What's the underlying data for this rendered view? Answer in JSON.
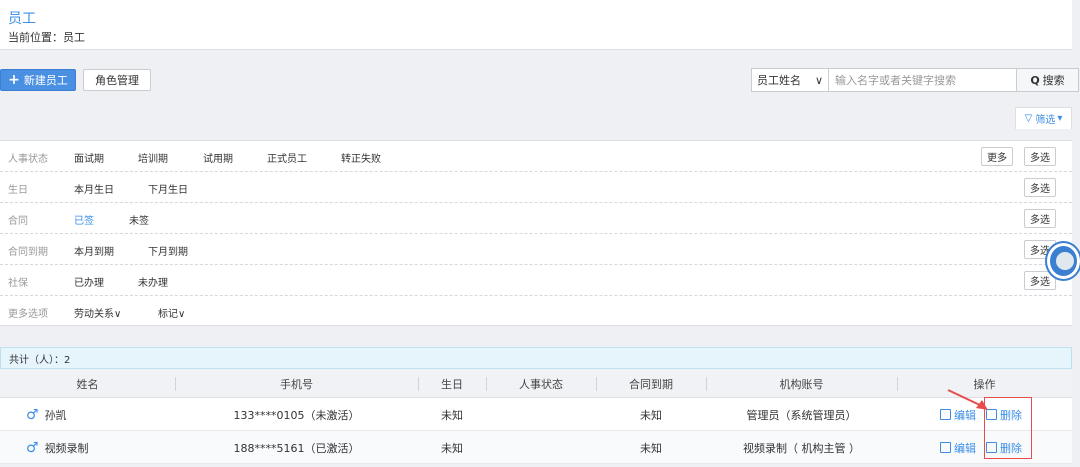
{
  "header": {
    "title": "员工",
    "breadcrumb": "当前位置：员工"
  },
  "toolbar": {
    "new_label": "新建员工",
    "role_label": "角色管理"
  },
  "search": {
    "field_label": "员工姓名",
    "placeholder": "输入名字或者关键字搜索",
    "button_label": "搜索"
  },
  "filter_toggle": {
    "label": "筛选"
  },
  "filters": [
    {
      "label": "人事状态",
      "options": [
        "面试期",
        "培训期",
        "试用期",
        "正式员工",
        "转正失败"
      ],
      "more_label": "更多",
      "multi_label": "多选"
    },
    {
      "label": "生日",
      "options": [
        "本月生日",
        "下月生日"
      ],
      "multi_label": "多选"
    },
    {
      "label": "合同",
      "options": [
        "已签",
        "未签"
      ],
      "active": "已签",
      "multi_label": "多选"
    },
    {
      "label": "合同到期",
      "options": [
        "本月到期",
        "下月到期"
      ],
      "multi_label": "多选"
    },
    {
      "label": "社保",
      "options": [
        "已办理",
        "未办理"
      ],
      "multi_label": "多选"
    },
    {
      "label": "更多选项",
      "options": [
        "劳动关系∨",
        "标记∨"
      ]
    }
  ],
  "count_text": "共计（人）：2",
  "table": {
    "headers": [
      "姓名",
      "手机号",
      "生日",
      "人事状态",
      "合同到期",
      "机构账号",
      "操作"
    ],
    "rows": [
      {
        "name": "孙凯",
        "phone": "133****0105（未激活）",
        "birthday": "未知",
        "status": "",
        "contract_due": "未知",
        "account": "管理员（系统管理员）",
        "edit": "编辑",
        "delete": "删除"
      },
      {
        "name": "视频录制",
        "phone": "188****5161（已激活）",
        "birthday": "未知",
        "status": "",
        "contract_due": "未知",
        "account": "视频录制（ 机构主管 ）",
        "edit": "编辑",
        "delete": "删除"
      }
    ]
  },
  "colors": {
    "accent": "#3a8ee6",
    "primary_button": "#4a90e2",
    "highlight_box": "#e84c4c"
  },
  "icons": {
    "male": "male-icon",
    "edit": "edit-icon",
    "delete": "delete-icon",
    "search": "search-icon",
    "filter": "filter-icon",
    "dropdown": "chevron-down-icon"
  }
}
